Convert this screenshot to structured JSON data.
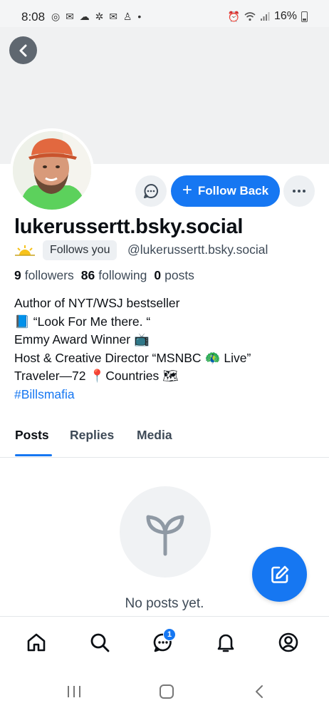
{
  "status_bar": {
    "time": "8:08",
    "battery": "16%",
    "left_icons": [
      "at-icon",
      "mail-icon",
      "cloud-icon",
      "pinwheel-icon",
      "mail-icon",
      "person-icon",
      "dot-icon"
    ],
    "right_icons": [
      "alarm-icon",
      "wifi-icon",
      "signal-icon",
      "battery-icon"
    ]
  },
  "profile": {
    "display_name": "lukerussertt.bsky.social",
    "follows_you_label": "Follows you",
    "handle": "@lukerussertt.bsky.social",
    "stats": {
      "followers_count": "9",
      "followers_label": "followers",
      "following_count": "86",
      "following_label": "following",
      "posts_count": "0",
      "posts_label": "posts"
    },
    "bio": {
      "line1": "Author of NYT/WSJ bestseller",
      "line2_emoji": "📘",
      "line2": "“Look For Me there. “",
      "line3": "Emmy Award Winner",
      "line3_emoji": "📺",
      "line4_a": "Host & Creative Director “MSNBC",
      "line4_emoji": "🦚",
      "line4_b": "Live”",
      "line5_a": "Traveler—72",
      "line5_emoji": "📍",
      "line5_b": "Countries",
      "line5_emoji2": "🗺",
      "hashtag": "#Billsmafia"
    }
  },
  "actions": {
    "follow_back_label": "Follow Back"
  },
  "tabs": [
    {
      "label": "Posts",
      "active": true
    },
    {
      "label": "Replies",
      "active": false
    },
    {
      "label": "Media",
      "active": false
    }
  ],
  "empty_state": {
    "text": "No posts yet.",
    "icon": "sprout-icon"
  },
  "bottom_nav": {
    "items": [
      "home-icon",
      "search-icon",
      "chat-icon",
      "bell-icon",
      "profile-icon"
    ],
    "chat_badge": "1"
  },
  "colors": {
    "accent": "#1677f2",
    "muted_text": "#3e4a57",
    "banner": "#f0f1f2"
  }
}
